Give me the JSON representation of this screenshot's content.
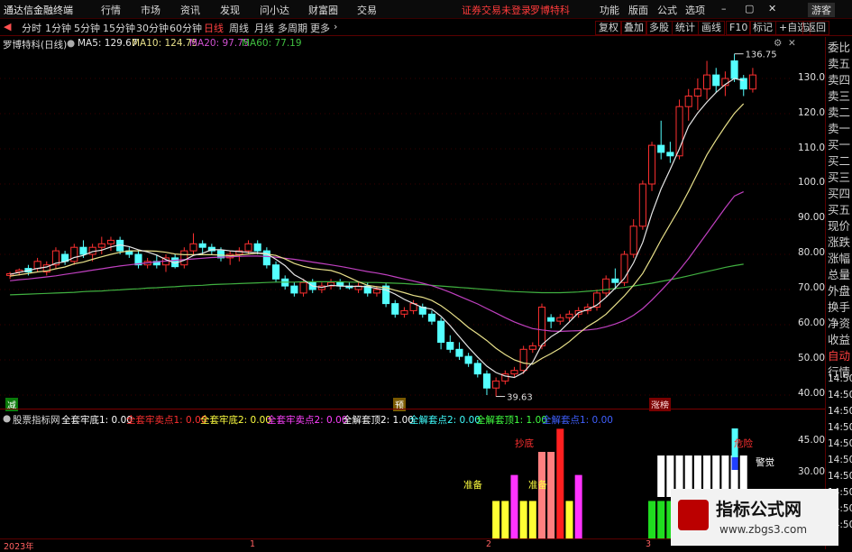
{
  "topbar": {
    "app_title": "通达信金融终端",
    "menus": [
      "行情",
      "市场",
      "资讯",
      "发现",
      "问小达",
      "财富圈",
      "交易"
    ],
    "status": "证券交易未登录",
    "stock": "罗博特科",
    "right_menus": [
      "功能",
      "版面",
      "公式",
      "选项"
    ],
    "user": "游客"
  },
  "periodbar": {
    "periods": [
      "分时",
      "1分钟",
      "5分钟",
      "15分钟",
      "30分钟",
      "60分钟",
      "日线",
      "周线",
      "月线",
      "多周期",
      "更多"
    ],
    "active": "日线",
    "tools": [
      "复权",
      "叠加",
      "多股",
      "统计",
      "画线",
      "F10",
      "标记",
      "+自选",
      "返回"
    ]
  },
  "info": {
    "title": "罗博特科(日线)",
    "ma5": "MA5: 129.67",
    "ma10": "MA10: 124.75",
    "ma20": "MA20: 97.75",
    "ma60": "MA60: 77.19"
  },
  "colors": {
    "up": "#ff3030",
    "down": "#54ffff",
    "ma5": "#e6e6e6",
    "ma10": "#e8e08a",
    "ma20": "#c040c0",
    "ma60": "#40b040"
  },
  "rightpanel": [
    "委比",
    "卖五",
    "卖四",
    "卖三",
    "卖二",
    "卖一",
    "买一",
    "买二",
    "买三",
    "买四",
    "买五",
    "现价",
    "涨跌",
    "涨幅",
    "总量",
    "外盘",
    "换手",
    "净资",
    "收益",
    "自动",
    "行情"
  ],
  "yaxis": [
    "130.00",
    "120.00",
    "110.00",
    "100.00",
    "90.00",
    "80.00",
    "70.00",
    "60.00",
    "50.00",
    "40.00"
  ],
  "time_labels": [
    "14:50",
    "14:50",
    "14:50",
    "14:50",
    "14:50",
    "14:50",
    "14:50",
    "14:50",
    "14:50",
    "14:50"
  ],
  "max_label": "136.75",
  "min_label": "39.63",
  "markers": {
    "left": "减",
    "mid": "预",
    "right": "涨榜"
  },
  "sub": {
    "name": "股票指标网",
    "items": [
      "全套牢底1: 0.00",
      "全套牢卖点1: 0.00",
      "全套牢底2: 0.00",
      "全套牢卖点2: 0.00",
      "全解套顶2: 1.00",
      "全解套点2: 0.00",
      "全解套顶1: 1.00",
      "全解套点1: 0.00"
    ],
    "yaxis": [
      "45.00",
      "30.00",
      "15.00"
    ],
    "labels": {
      "chaodi": "抄底",
      "zhunbei1": "准备",
      "zhunbei2": "准备",
      "weixian": "危险",
      "jingjue": "警觉"
    }
  },
  "bottom": {
    "year": "2023年",
    "m1": "1",
    "m2": "2",
    "m3": "3"
  },
  "watermark": {
    "title": "指标公式网",
    "url": "www.zbgs3.com"
  },
  "chart_data": {
    "type": "candlestick",
    "title": "罗博特科(日线)",
    "ylim": [
      38,
      140
    ],
    "yticks": [
      40,
      50,
      60,
      70,
      80,
      90,
      100,
      110,
      120,
      130
    ],
    "candles": [
      [
        74,
        75,
        73,
        74.5
      ],
      [
        75,
        76,
        74,
        75.5
      ],
      [
        76,
        77,
        74,
        75
      ],
      [
        76,
        79,
        75,
        78
      ],
      [
        75,
        78,
        74,
        77
      ],
      [
        77,
        82,
        76,
        81
      ],
      [
        80,
        81,
        77,
        78
      ],
      [
        78,
        83,
        77,
        82
      ],
      [
        82,
        84,
        79,
        80
      ],
      [
        80,
        83,
        78,
        82
      ],
      [
        82,
        85,
        80,
        83
      ],
      [
        83,
        85,
        81,
        84
      ],
      [
        84,
        85,
        80,
        81
      ],
      [
        81,
        82,
        79,
        80
      ],
      [
        80,
        81,
        76,
        77
      ],
      [
        77,
        79,
        76,
        78
      ],
      [
        78,
        80,
        76,
        77
      ],
      [
        77,
        80,
        75,
        79
      ],
      [
        79,
        80,
        76,
        76.5
      ],
      [
        77,
        82,
        76,
        81
      ],
      [
        81,
        86,
        80,
        83
      ],
      [
        83,
        84,
        80,
        82
      ],
      [
        82,
        83,
        80,
        81
      ],
      [
        81,
        82,
        78,
        79
      ],
      [
        79,
        81,
        77,
        80
      ],
      [
        80,
        82,
        78,
        81
      ],
      [
        81,
        84,
        80,
        83
      ],
      [
        83,
        84,
        80,
        81
      ],
      [
        81,
        82,
        76,
        77
      ],
      [
        77,
        78,
        72,
        73
      ],
      [
        73,
        74,
        70,
        71
      ],
      [
        71,
        72,
        68,
        69
      ],
      [
        69,
        73,
        68,
        72
      ],
      [
        72,
        73,
        69,
        70
      ],
      [
        70,
        72,
        69,
        71
      ],
      [
        71,
        73,
        70,
        72
      ],
      [
        72,
        73,
        70,
        71
      ],
      [
        71,
        72,
        70,
        70.5
      ],
      [
        70,
        72,
        69,
        71
      ],
      [
        71,
        72,
        68,
        69
      ],
      [
        69,
        71,
        68,
        70
      ],
      [
        71,
        72,
        65,
        66
      ],
      [
        66,
        67,
        62,
        63
      ],
      [
        63,
        65,
        62,
        64
      ],
      [
        64,
        67,
        63,
        66
      ],
      [
        65,
        66,
        62,
        63
      ],
      [
        63,
        64,
        60,
        61
      ],
      [
        61,
        62,
        53,
        55
      ],
      [
        55,
        57,
        52,
        53
      ],
      [
        53,
        55,
        50,
        51
      ],
      [
        51,
        52,
        48,
        49
      ],
      [
        49,
        50,
        45,
        46
      ],
      [
        46,
        47,
        40,
        42
      ],
      [
        42,
        45,
        39.6,
        44
      ],
      [
        44,
        47,
        43,
        46
      ],
      [
        46,
        48,
        45,
        47
      ],
      [
        47,
        54,
        46,
        53
      ],
      [
        53,
        55,
        52,
        54
      ],
      [
        54,
        66,
        53,
        65
      ],
      [
        62,
        63,
        59,
        61
      ],
      [
        61,
        63,
        60,
        62
      ],
      [
        62,
        64,
        61,
        63
      ],
      [
        63,
        65,
        62,
        64
      ],
      [
        64,
        66,
        63,
        65
      ],
      [
        65,
        70,
        64,
        69
      ],
      [
        69,
        74,
        68,
        73
      ],
      [
        73,
        76,
        70,
        72
      ],
      [
        72,
        81,
        71,
        80
      ],
      [
        80,
        90,
        79,
        88
      ],
      [
        88,
        101,
        87,
        100
      ],
      [
        100,
        112,
        98,
        111
      ],
      [
        111,
        118,
        107,
        109
      ],
      [
        109,
        112,
        106,
        108
      ],
      [
        108,
        124,
        107,
        122
      ],
      [
        122,
        127,
        118,
        125
      ],
      [
        125,
        130,
        121,
        127
      ],
      [
        127,
        135,
        124,
        131
      ],
      [
        131,
        133,
        126,
        128
      ],
      [
        128,
        132,
        125,
        130
      ],
      [
        135,
        137,
        129,
        130
      ],
      [
        130,
        131,
        125,
        127
      ],
      [
        127,
        133,
        126,
        131
      ]
    ],
    "ma5": [
      74.3,
      74.9,
      75.4,
      76.0,
      76.4,
      77.5,
      77.9,
      79.1,
      79.7,
      80.8,
      81.2,
      82.1,
      82.7,
      82.2,
      81.3,
      80.7,
      79.8,
      78.5,
      77.5,
      78.3,
      79.7,
      80.3,
      81.3,
      81.3,
      81.0,
      80.8,
      80.6,
      80.4,
      80.2,
      78.6,
      76.8,
      74.2,
      72.8,
      71.0,
      70.6,
      71.2,
      71.0,
      70.9,
      70.9,
      70.8,
      70.3,
      69.9,
      68.7,
      67.2,
      66.0,
      64.9,
      64.4,
      62.4,
      59.7,
      56.6,
      53.6,
      50.8,
      48.2,
      46.4,
      45.4,
      45.0,
      46.4,
      49.3,
      54.3,
      56.6,
      58.2,
      60.8,
      63.4,
      64.3,
      65.6,
      67.8,
      70.4,
      73.2,
      77.6,
      83.4,
      91.6,
      98.6,
      104.2,
      110.0,
      116.4,
      120.2,
      123.3,
      126.0,
      128.3,
      130.0,
      129.4
    ],
    "ma10": [
      73.8,
      74.2,
      74.6,
      75.0,
      75.3,
      75.9,
      76.4,
      77.3,
      77.8,
      78.6,
      79.3,
      80.0,
      80.6,
      81.0,
      81.0,
      81.0,
      80.9,
      80.6,
      80.1,
      79.9,
      79.9,
      79.9,
      79.9,
      79.8,
      79.6,
      79.8,
      80.1,
      80.3,
      80.1,
      79.7,
      78.7,
      77.4,
      76.6,
      76.0,
      75.7,
      75.4,
      74.6,
      73.4,
      72.2,
      71.2,
      70.8,
      70.5,
      69.8,
      69.1,
      68.3,
      67.8,
      66.9,
      65.4,
      63.5,
      61.4,
      59.2,
      57.4,
      55.5,
      53.3,
      51.5,
      50.0,
      49.1,
      48.8,
      50.4,
      51.8,
      53.3,
      55.2,
      57.5,
      59.5,
      61.1,
      63.0,
      65.6,
      68.2,
      71.2,
      74.6,
      79.2,
      84.1,
      88.6,
      93.0,
      97.9,
      103.1,
      108.3,
      112.5,
      116.4,
      120.1,
      122.8
    ],
    "ma20": [
      72.5,
      72.8,
      73.0,
      73.3,
      73.6,
      73.9,
      74.3,
      74.7,
      75.1,
      75.5,
      75.9,
      76.3,
      76.7,
      77.0,
      77.3,
      77.6,
      77.9,
      78.1,
      78.3,
      78.5,
      78.7,
      78.9,
      79.1,
      79.2,
      79.3,
      79.4,
      79.5,
      79.5,
      79.4,
      79.2,
      78.9,
      78.6,
      78.2,
      77.8,
      77.4,
      77.0,
      76.6,
      76.1,
      75.6,
      75.1,
      74.7,
      74.2,
      73.6,
      73.0,
      72.4,
      71.8,
      71.1,
      70.2,
      69.2,
      68.1,
      67.0,
      65.9,
      64.6,
      63.3,
      62.0,
      60.8,
      59.8,
      58.9,
      58.5,
      58.2,
      58.1,
      58.2,
      58.3,
      58.5,
      58.8,
      59.4,
      60.2,
      61.2,
      62.7,
      64.6,
      67.0,
      69.7,
      72.5,
      75.5,
      78.8,
      82.4,
      86.0,
      89.6,
      93.2,
      96.6,
      97.8
    ],
    "ma60": [
      68.5,
      68.6,
      68.7,
      68.8,
      68.9,
      69.0,
      69.1,
      69.2,
      69.4,
      69.5,
      69.6,
      69.8,
      69.9,
      70.1,
      70.2,
      70.4,
      70.5,
      70.7,
      70.8,
      71.0,
      71.1,
      71.2,
      71.4,
      71.5,
      71.6,
      71.7,
      71.8,
      71.9,
      72.0,
      72.1,
      72.1,
      72.1,
      72.2,
      72.2,
      72.2,
      72.2,
      72.2,
      72.1,
      72.1,
      72.0,
      72.0,
      71.9,
      71.8,
      71.7,
      71.5,
      71.4,
      71.2,
      71.0,
      70.8,
      70.6,
      70.4,
      70.2,
      70.0,
      69.8,
      69.6,
      69.4,
      69.3,
      69.2,
      69.1,
      69.1,
      69.1,
      69.2,
      69.3,
      69.5,
      69.7,
      70.0,
      70.3,
      70.6,
      71.0,
      71.4,
      71.8,
      72.3,
      72.8,
      73.3,
      73.9,
      74.5,
      75.1,
      75.7,
      76.3,
      76.8,
      77.2
    ],
    "sub_bars": [
      {
        "i": 53,
        "h": 13,
        "c": "#ffff33"
      },
      {
        "i": 54,
        "h": 13,
        "c": "#ffff33"
      },
      {
        "i": 55,
        "h": 22,
        "c": "#ff33ff"
      },
      {
        "i": 56,
        "h": 13,
        "c": "#ffff33"
      },
      {
        "i": 57,
        "h": 13,
        "c": "#ffff33"
      },
      {
        "i": 58,
        "h": 30,
        "c": "#ff8080"
      },
      {
        "i": 59,
        "h": 30,
        "c": "#ff8080"
      },
      {
        "i": 60,
        "h": 38,
        "c": "#ff2020"
      },
      {
        "i": 61,
        "h": 13,
        "c": "#ffff33"
      },
      {
        "i": 62,
        "h": 22,
        "c": "#ff33ff"
      },
      {
        "i": 70,
        "h": 13,
        "c": "#20dd20"
      },
      {
        "i": 71,
        "h": 13,
        "c": "#20dd20"
      },
      {
        "i": 72,
        "h": 13,
        "c": "#20dd20"
      },
      {
        "i": 73,
        "h": 13,
        "c": "#20dd20"
      },
      {
        "i": 74,
        "h": 13,
        "c": "#20dd20"
      },
      {
        "i": 75,
        "h": 13,
        "c": "#20dd20"
      },
      {
        "i": 76,
        "h": 13,
        "c": "#20dd20"
      },
      {
        "i": 77,
        "h": 13,
        "c": "#20dd20"
      },
      {
        "i": 78,
        "h": 13,
        "c": "#20dd20"
      },
      {
        "i": 79,
        "h": 13,
        "c": "#20dd20"
      },
      {
        "i": 80,
        "h": 13,
        "c": "#20dd20"
      }
    ],
    "sub_white": [
      71,
      72,
      73,
      74,
      75,
      76,
      77,
      78,
      79,
      80
    ]
  }
}
